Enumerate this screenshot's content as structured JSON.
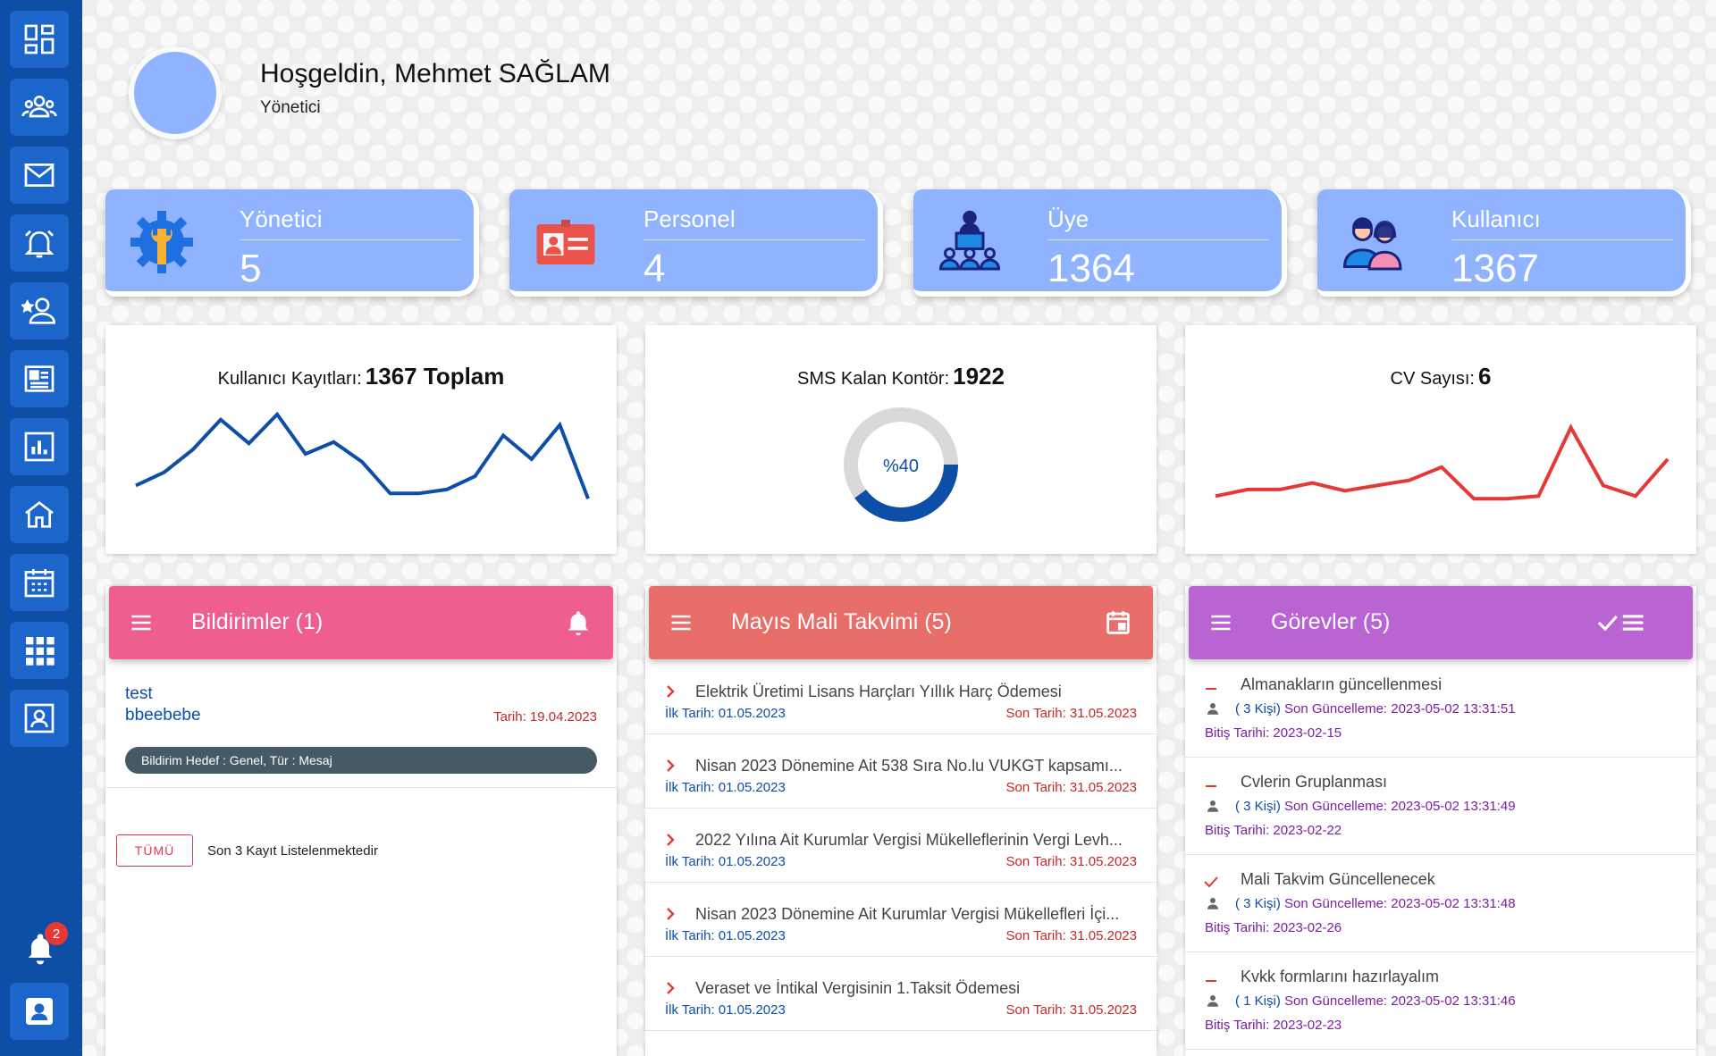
{
  "header": {
    "greeting": "Hoşgeldin, Mehmet SAĞLAM",
    "role": "Yönetici"
  },
  "sidebar": {
    "items": [
      {
        "icon": "dashboard-icon"
      },
      {
        "icon": "users-group-icon"
      },
      {
        "icon": "mail-icon"
      },
      {
        "icon": "alarm-icon"
      },
      {
        "icon": "add-person-icon"
      },
      {
        "icon": "newspaper-icon"
      },
      {
        "icon": "bar-chart-icon"
      },
      {
        "icon": "home-icon"
      },
      {
        "icon": "calendar-icon"
      },
      {
        "icon": "apps-grid-icon"
      },
      {
        "icon": "contact-card-icon"
      }
    ],
    "notification_badge": "2"
  },
  "stats": [
    {
      "label": "Yönetici",
      "value": "5",
      "icon": "settings-wrench-icon"
    },
    {
      "label": "Personel",
      "value": "4",
      "icon": "id-card-icon"
    },
    {
      "label": "Üye",
      "value": "1364",
      "icon": "presenter-icon"
    },
    {
      "label": "Kullanıcı",
      "value": "1367",
      "icon": "users-pair-icon"
    }
  ],
  "charts": {
    "registrations": {
      "label": "Kullanıcı Kayıtları:",
      "value": "1367 Toplam",
      "color": "#0d4ea6"
    },
    "sms": {
      "label": "SMS Kalan Kontör:",
      "value": "1922",
      "percent_label": "%40",
      "color": "#0d4ea6"
    },
    "cv": {
      "label": "CV Sayısı:",
      "value": "6",
      "color": "#e53935"
    }
  },
  "chart_data": [
    {
      "type": "line",
      "title": "Kullanıcı Kayıtları: 1367 Toplam",
      "series": [
        {
          "values": [
            18,
            28,
            45,
            68,
            50,
            72,
            42,
            51,
            36,
            12,
            12,
            15,
            25,
            56,
            38,
            64,
            8
          ]
        }
      ],
      "ylim": [
        0,
        80
      ],
      "grid": false
    },
    {
      "type": "pie",
      "title": "SMS Kalan Kontör: 1922",
      "values": [
        40,
        60
      ],
      "labels": [
        "%40",
        ""
      ],
      "colors": [
        "#0d4ea6",
        "#d9d9d9"
      ]
    },
    {
      "type": "line",
      "title": "CV Sayısı: 6",
      "series": [
        {
          "values": [
            10,
            15,
            15,
            20,
            14,
            18,
            22,
            32,
            8,
            8,
            10,
            62,
            18,
            10,
            38
          ]
        }
      ],
      "ylim": [
        0,
        80
      ],
      "grid": false
    }
  ],
  "notifications": {
    "title": "Bildirimler (1)",
    "color": "#ee5f8f",
    "items": [
      {
        "title": "test",
        "body": "bbeebebe",
        "date": "Tarih: 19.04.2023",
        "pill": "Bildirim Hedef : Genel,  Tür : Mesaj"
      }
    ],
    "all_button": "TÜMÜ",
    "note": "Son 3 Kayıt Listelenmektedir"
  },
  "calendar": {
    "title": "Mayıs Mali Takvimi (5)",
    "color": "#e86e6a",
    "items": [
      {
        "title": "Elektrik Üretimi Lisans Harçları Yıllık Harç Ödemesi",
        "start": "İlk Tarih: 01.05.2023",
        "end": "Son Tarih: 31.05.2023"
      },
      {
        "title": "Nisan 2023 Dönemine Ait 538 Sıra No.lu VUKGT kapsamı...",
        "start": "İlk Tarih: 01.05.2023",
        "end": "Son Tarih: 31.05.2023"
      },
      {
        "title": "2022 Yılına Ait Kurumlar Vergisi Mükelleflerinin Vergi Levh...",
        "start": "İlk Tarih: 01.05.2023",
        "end": "Son Tarih: 31.05.2023"
      },
      {
        "title": "Nisan 2023 Dönemine Ait Kurumlar Vergisi Mükellefleri İçi...",
        "start": "İlk Tarih: 01.05.2023",
        "end": "Son Tarih: 31.05.2023"
      },
      {
        "title": "Veraset ve İntikal Vergisinin 1.Taksit Ödemesi",
        "start": "İlk Tarih: 01.05.2023",
        "end": "Son Tarih: 31.05.2023"
      }
    ]
  },
  "tasks": {
    "title": "Görevler (5)",
    "color": "#b964d2",
    "items": [
      {
        "title": "Almanakların güncellenmesi",
        "status": "pending",
        "count": "( 3 Kişi)",
        "updated": "Son Güncelleme: 2023-05-02 13:31:51",
        "due": "Bitiş Tarihi: 2023-02-15"
      },
      {
        "title": "Cvlerin Gruplanması",
        "status": "pending",
        "count": "( 3 Kişi)",
        "updated": "Son Güncelleme: 2023-05-02 13:31:49",
        "due": "Bitiş Tarihi: 2023-02-22"
      },
      {
        "title": "Mali Takvim Güncellenecek",
        "status": "done",
        "count": "( 3 Kişi)",
        "updated": "Son Güncelleme: 2023-05-02 13:31:48",
        "due": "Bitiş Tarihi: 2023-02-26"
      },
      {
        "title": "Kvkk formlarını hazırlayalım",
        "status": "pending",
        "count": "( 1 Kişi)",
        "updated": "Son Güncelleme: 2023-05-02 13:31:46",
        "due": "Bitiş Tarihi: 2023-02-23"
      }
    ]
  }
}
